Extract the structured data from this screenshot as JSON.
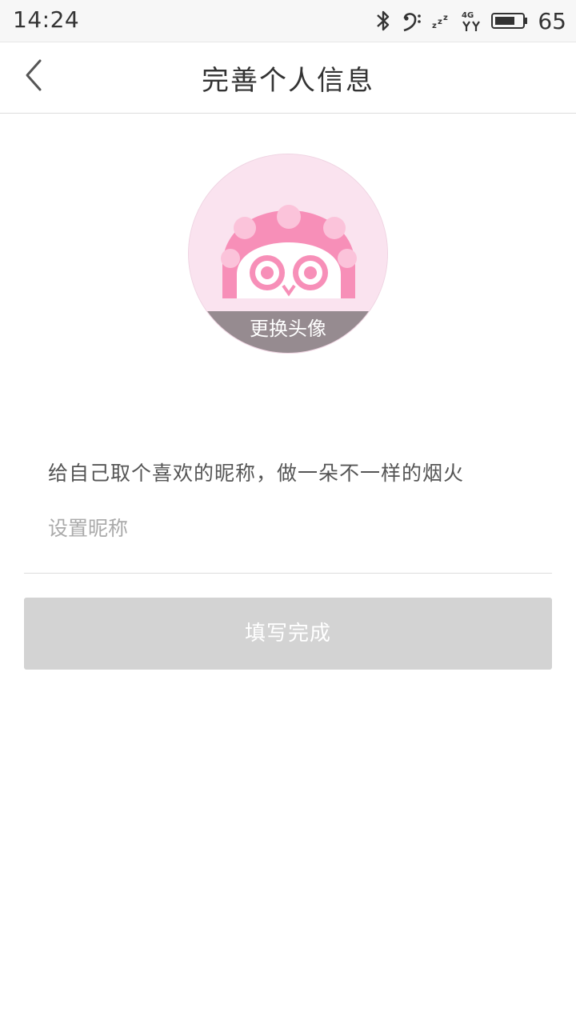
{
  "status_bar": {
    "time": "14:24",
    "battery_level": "65",
    "icons": [
      "bluetooth-icon",
      "bass-clef-icon",
      "sleep-zzz-icon",
      "signal-4g-icon",
      "battery-icon"
    ],
    "network_label": "4G"
  },
  "header": {
    "title": "完善个人信息",
    "back_icon": "chevron-left-icon"
  },
  "avatar": {
    "change_label": "更换头像",
    "background_color": "#fae3ef",
    "accent_color": "#f78fb8"
  },
  "form": {
    "prompt": "给自己取个喜欢的昵称，做一朵不一样的烟火",
    "nickname_value": "",
    "nickname_placeholder": "设置昵称"
  },
  "actions": {
    "submit_label": "填写完成",
    "submit_color": "#d3d3d3"
  }
}
